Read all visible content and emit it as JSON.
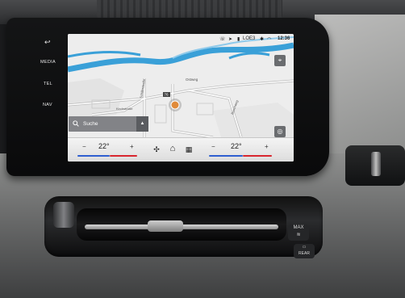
{
  "side_buttons": {
    "back": "↩",
    "media": "MEDIA",
    "tel": "TEL",
    "nav": "NAV"
  },
  "status_bar": {
    "icons": [
      "phone-icon",
      "nav-arrow-icon",
      "signal-icon",
      "bluetooth-icon",
      "wifi-icon"
    ],
    "network": "LOE3",
    "time": "12:36"
  },
  "map": {
    "labels": {
      "road_a": "Ostweg",
      "road_b": "Schillerstraße",
      "road_c": "Kirchstraße",
      "road_d": "Buschweg",
      "marker_badge": "76"
    },
    "colors": {
      "water": "#3aa0d8",
      "road": "#ffffff",
      "road_edge": "#b9b9b9",
      "park": "#d6e6c8"
    }
  },
  "search": {
    "label": "Suche",
    "expand_icon": "chevron-up-icon"
  },
  "map_controls": {
    "top_button_icon": "compass-icon",
    "bottom_button_icon": "target-icon"
  },
  "climate": {
    "left": {
      "temp": "22°",
      "minus": "−",
      "plus": "+"
    },
    "right": {
      "temp": "22°",
      "minus": "−",
      "plus": "+"
    },
    "center_icons": [
      "fan-icon",
      "home-icon",
      "apps-icon"
    ]
  },
  "dashboard": {
    "max_button": "MAX",
    "rear_button": "REAR"
  }
}
